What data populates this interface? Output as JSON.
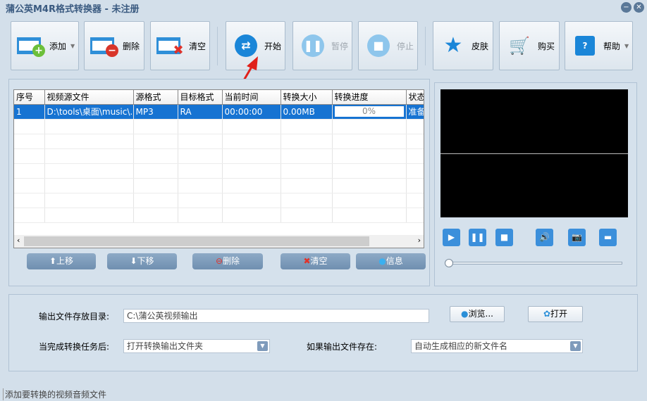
{
  "app": {
    "title": "蒲公英M4R格式转换器 - 未注册"
  },
  "toolbar": {
    "add": "添加",
    "delete": "删除",
    "clear": "清空",
    "start": "开始",
    "pause": "暂停",
    "stop": "停止",
    "skin": "皮肤",
    "buy": "购买",
    "help": "帮助"
  },
  "table": {
    "columns": [
      "序号",
      "视频源文件",
      "源格式",
      "目标格式",
      "当前时间",
      "转换大小",
      "转换进度",
      "状态"
    ],
    "rows": [
      {
        "index": "1",
        "file": "D:\\tools\\桌面\\music\\...",
        "src": "MP3",
        "dst": "RA",
        "time": "00:00:00",
        "size": "0.00MB",
        "progress": "0%",
        "status": "准备"
      }
    ]
  },
  "list_buttons": {
    "up": "上移",
    "down": "下移",
    "delete": "删除",
    "clear": "清空",
    "info": "信息"
  },
  "output": {
    "dir_label": "输出文件存放目录:",
    "dir_value": "C:\\蒲公英视频输出",
    "browse": "浏览...",
    "open": "打开",
    "after_label": "当完成转换任务后:",
    "after_value": "打开转换输出文件夹",
    "exists_label": "如果输出文件存在:",
    "exists_value": "自动生成相应的新文件名"
  },
  "status_bar": "添加要转换的视频音频文件",
  "colors": {
    "accent": "#1673d2",
    "background": "#d3dfea"
  }
}
